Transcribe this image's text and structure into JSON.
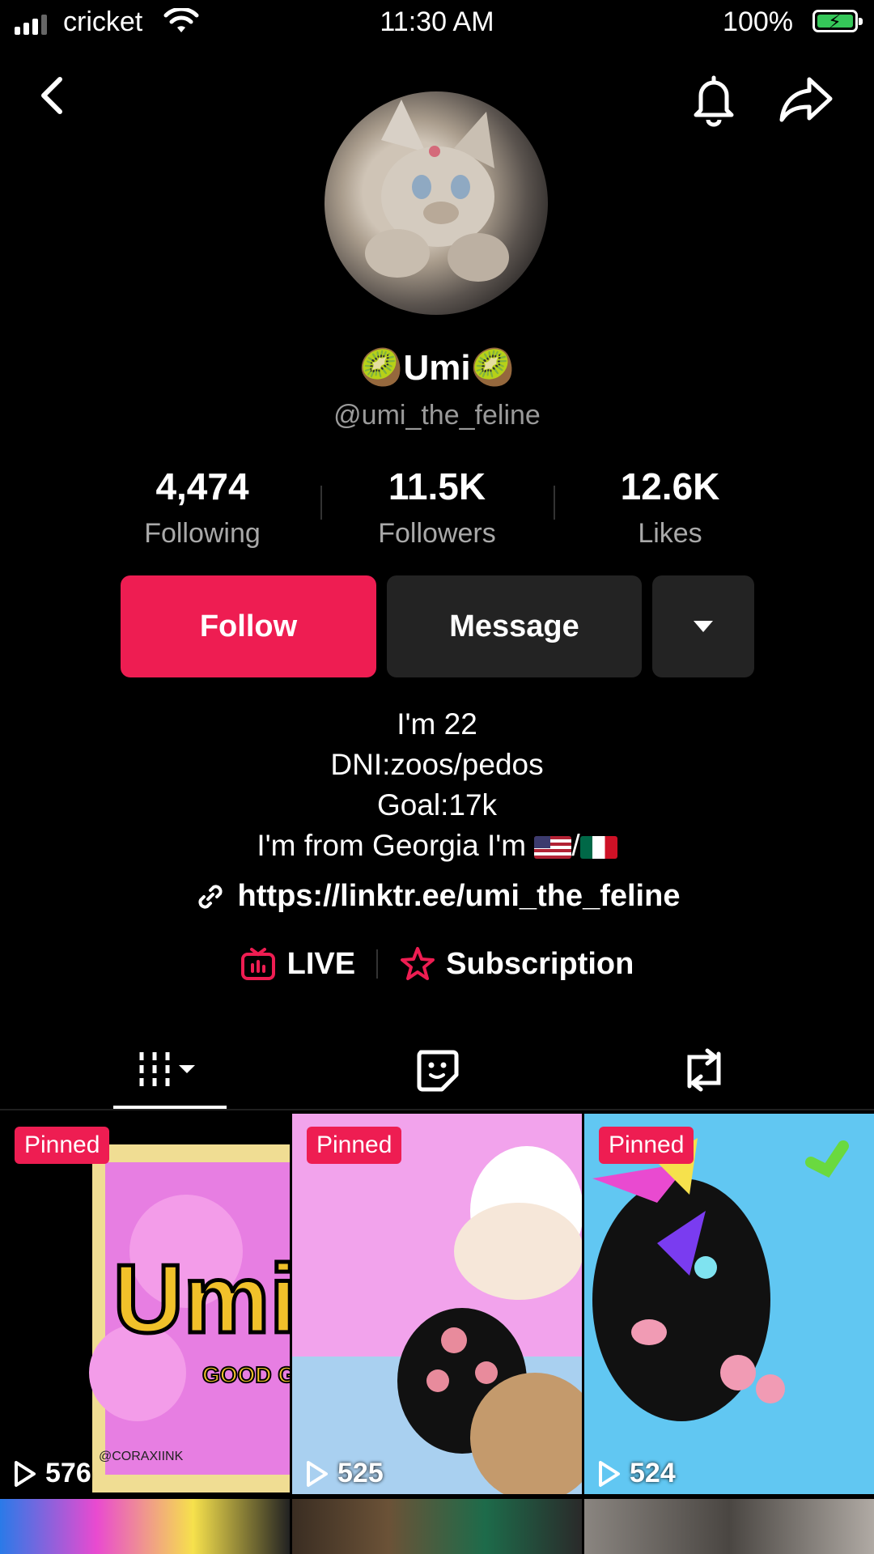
{
  "status_bar": {
    "carrier": "cricket",
    "time": "11:30 AM",
    "battery": "100%"
  },
  "profile": {
    "display_name": "Umi",
    "name_emoji": "🥝",
    "handle": "@umi_the_feline",
    "stats": [
      {
        "value": "4,474",
        "label": "Following"
      },
      {
        "value": "11.5K",
        "label": "Followers"
      },
      {
        "value": "12.6K",
        "label": "Likes"
      }
    ],
    "follow_label": "Follow",
    "message_label": "Message",
    "bio_lines": [
      "I'm 22",
      "DNI:zoos/pedos",
      "Goal:17k",
      "I'm from Georgia I'm"
    ],
    "bio_flag_separator": "/",
    "link": "https://linktr.ee/umi_the_feline",
    "live_label": "LIVE",
    "subscription_label": "Subscription"
  },
  "videos": [
    {
      "pinned": "Pinned",
      "views": "576",
      "art_text": "Umi",
      "art_sub": "GOOD GIRL",
      "watermark": "@CORAXIINK"
    },
    {
      "pinned": "Pinned",
      "views": "525"
    },
    {
      "pinned": "Pinned",
      "views": "524"
    }
  ],
  "colors": {
    "accent": "#ee1d52",
    "button_dark": "#232323",
    "muted_text": "#9a9a9a"
  }
}
